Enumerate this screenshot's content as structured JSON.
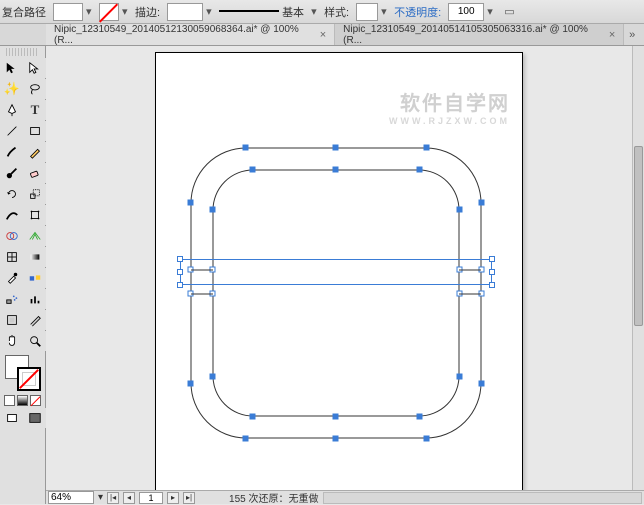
{
  "topbar": {
    "object_label": "复合路径",
    "stroke_label": "描边:",
    "stroke_weight": "",
    "stroke_basic": "基本",
    "style_label": "样式:",
    "opacity_label": "不透明度:",
    "opacity_value": "100"
  },
  "tabs": [
    {
      "title": "Nipic_12310549_20140512130059068364.ai* @ 100% (R...",
      "active": true
    },
    {
      "title": "Nipic_12310549_20140514105305063316.ai* @ 100% (R...",
      "active": false
    }
  ],
  "watermark": {
    "main": "软件自学网",
    "sub": "WWW.RJZXW.COM"
  },
  "statusbar": {
    "zoom": "64%",
    "page": "1",
    "history_text": "155 次还原：无重做"
  },
  "tools": [
    "selection",
    "direct-selection",
    "magic-wand",
    "lasso",
    "pen",
    "type",
    "line",
    "rectangle",
    "paintbrush",
    "pencil",
    "blob-brush",
    "eraser",
    "rotate",
    "scale",
    "width",
    "free-transform",
    "shape-builder",
    "perspective",
    "mesh",
    "gradient",
    "eyedropper",
    "blend",
    "symbol-sprayer",
    "column-graph",
    "artboard",
    "slice",
    "hand",
    "zoom"
  ],
  "colors": {
    "fill": "#ffffff",
    "stroke": "none"
  }
}
